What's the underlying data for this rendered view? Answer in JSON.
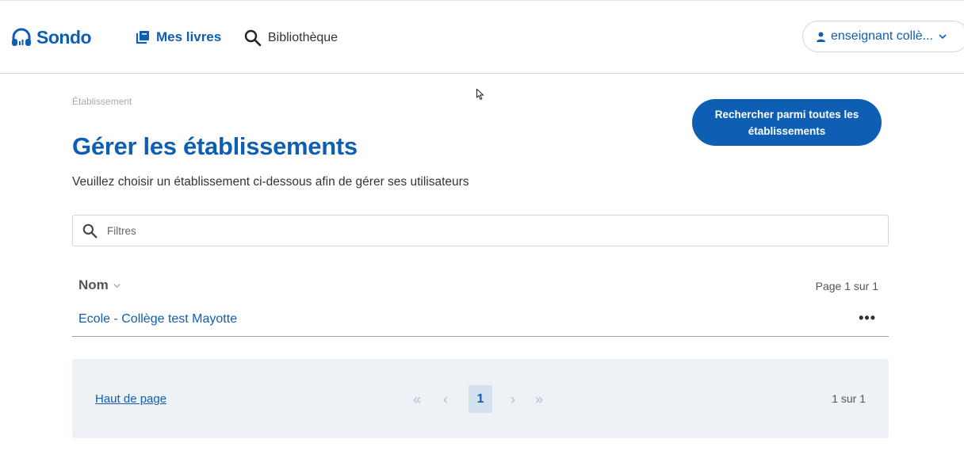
{
  "header": {
    "logo_text": "Sondo",
    "nav": {
      "books_label": "Mes livres",
      "library_label": "Bibliothèque"
    },
    "user_label": "enseignant collè..."
  },
  "main": {
    "breadcrumb": "Établissement",
    "title": "Gérer les établissements",
    "subtitle": "Veuillez choisir un établissement ci-dessous afin de gérer ses utilisateurs",
    "search_all_button": "Rechercher parmi toutes les établissements",
    "filter": {
      "placeholder": "Filtres",
      "value": ""
    },
    "table": {
      "column_name": "Nom",
      "page_info": "Page 1 sur 1",
      "rows": [
        {
          "name": "Ecole - Collège test Mayotte",
          "more": "•••"
        }
      ]
    },
    "pager": {
      "top_link": "Haut de page",
      "first": "«",
      "prev": "‹",
      "current_page": "1",
      "next": "›",
      "last": "»",
      "info": "1 sur 1"
    }
  },
  "colors": {
    "brand": "#0e5fb3",
    "pager_bg": "#eef2f6",
    "pager_current_bg": "#d3e1ee",
    "disabled_arrow": "#a9c1d8"
  },
  "icons": {
    "logo": "headphones-icon",
    "books": "books-icon",
    "library": "search-icon",
    "user": "person-icon",
    "user_dropdown": "chevron-down-icon",
    "filter": "search-icon",
    "sort": "chevron-down-icon",
    "cursor": "mouse-pointer-icon"
  }
}
